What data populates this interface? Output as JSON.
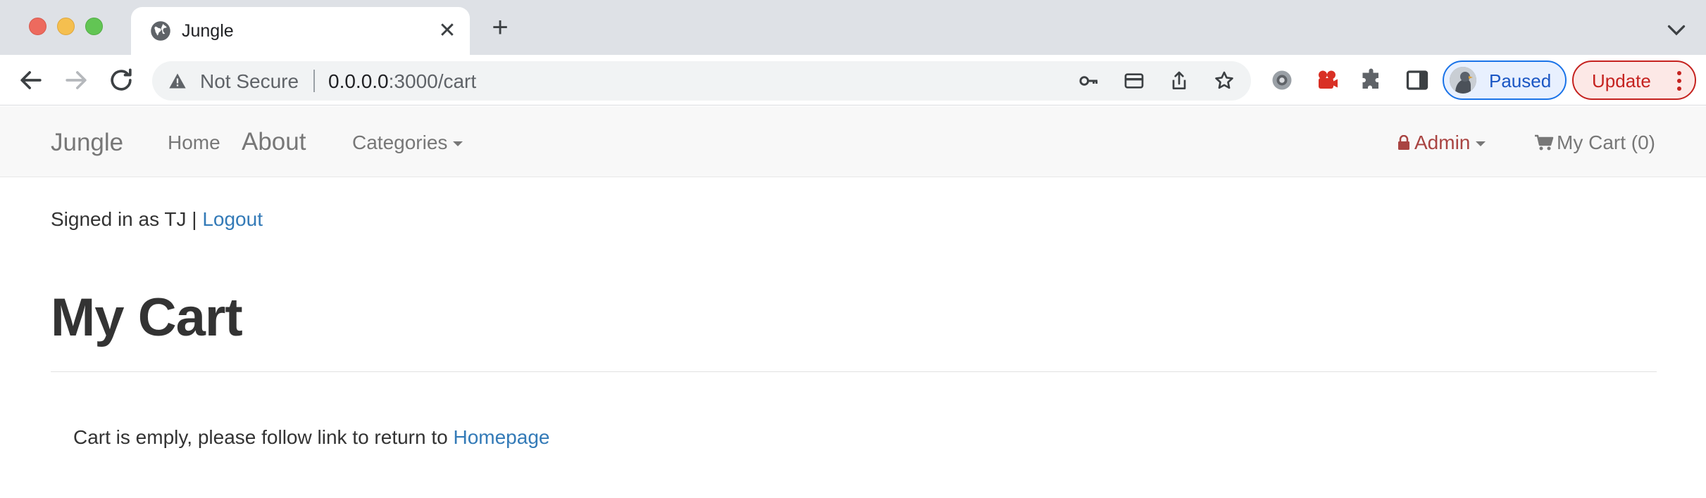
{
  "browser": {
    "tab_title": "Jungle",
    "close_glyph": "✕",
    "new_tab_glyph": "+",
    "omnibox": {
      "security_label": "Not Secure",
      "url_host": "0.0.0.0",
      "url_path": ":3000/cart"
    },
    "profile_label": "Paused",
    "update_label": "Update",
    "colors": {
      "tabbar": "#dee1e6",
      "accent": "#1a73e8",
      "update": "#c5221f"
    }
  },
  "navbar": {
    "brand": "Jungle",
    "links": {
      "home": "Home",
      "about": "About",
      "categories": "Categories"
    },
    "admin": "Admin",
    "cart": "My Cart (0)"
  },
  "page": {
    "signed_in_text": "Signed in as TJ | ",
    "logout": "Logout",
    "title": "My Cart",
    "empty_text": "Cart is emply, please follow link to return to ",
    "homepage_link": "Homepage",
    "colors": {
      "link": "#337ab7",
      "admin": "#a94442"
    }
  }
}
